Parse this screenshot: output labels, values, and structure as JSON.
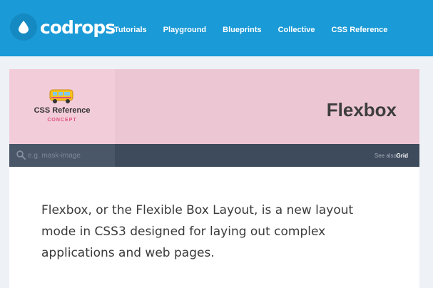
{
  "header": {
    "logo_text": "codrops",
    "nav": [
      "Tutorials",
      "Playground",
      "Blueprints",
      "Collective",
      "CSS Reference"
    ]
  },
  "hero": {
    "section_title": "CSS Reference",
    "section_tag": "CONCEPT",
    "page_title": "Flexbox"
  },
  "search": {
    "placeholder": "e.g. mask-image",
    "see_also_label": "See also",
    "see_also_link": "Grid"
  },
  "content": {
    "intro": "Flexbox, or the Flexible Box Layout, is a new layout mode in CSS3 designed for laying out complex applications and web pages."
  },
  "colors": {
    "header_bg": "#1a9ad6",
    "hero_bg": "#ecc6d2",
    "searchbar_bg": "#3e4b5d",
    "accent": "#e0527c"
  },
  "icons": [
    "drop-icon",
    "bus-icon",
    "search-icon"
  ]
}
